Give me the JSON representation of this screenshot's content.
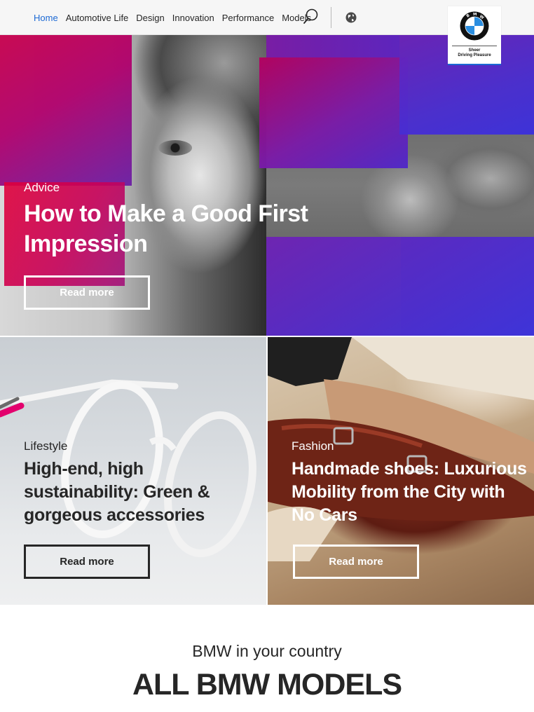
{
  "nav": {
    "items": [
      {
        "label": "Home",
        "active": true
      },
      {
        "label": "Automotive Life",
        "active": false
      },
      {
        "label": "Design",
        "active": false
      },
      {
        "label": "Innovation",
        "active": false
      },
      {
        "label": "Performance",
        "active": false
      },
      {
        "label": "Models",
        "active": false
      }
    ],
    "search_icon": "search-icon",
    "globe_icon": "globe-icon",
    "active_color": "#1c69d4"
  },
  "logo": {
    "claim_line1": "Sheer",
    "claim_line2": "Driving Pleasure",
    "roundel_letters": "BMW"
  },
  "hero": {
    "category": "Advice",
    "title": "How to Make a Good First Impression",
    "button_label": "Read more",
    "accent_colors": [
      "#c7004c",
      "#7a1aa8",
      "#3d33de"
    ]
  },
  "teasers": [
    {
      "category": "Lifestyle",
      "title": "High-end, high sustainability: Green & gorgeous accessories",
      "button_label": "Read more"
    },
    {
      "category": "Fashion",
      "title": "Handmade shoes: Luxurious Mobility from the City with No Cars",
      "button_label": "Read more"
    }
  ],
  "country": {
    "subtitle": "BMW in your country",
    "title": "ALL BMW MODELS"
  }
}
